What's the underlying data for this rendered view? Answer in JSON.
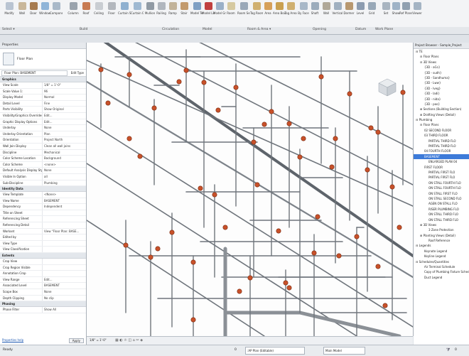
{
  "ribbon": {
    "buttons": [
      {
        "label": "Modify",
        "color": "#b9c4d2"
      },
      {
        "label": "Wall",
        "color": "#c9b79a"
      },
      {
        "label": "Door",
        "color": "#a77b4f"
      },
      {
        "label": "Window",
        "color": "#8fb4d8"
      },
      {
        "label": "Component",
        "color": "#a9b9c9"
      },
      {
        "label": "Column",
        "color": "#9aa3ad"
      },
      {
        "label": "Roof",
        "color": "#c77a52"
      },
      {
        "label": "Ceiling",
        "color": "#c9cdd2"
      },
      {
        "label": "Floor",
        "color": "#b3b7bd"
      },
      {
        "label": "Curtain System",
        "color": "#8fb0d0"
      },
      {
        "label": "Curtain Grid",
        "color": "#9fb9d2"
      },
      {
        "label": "Mullion",
        "color": "#909aa4"
      },
      {
        "label": "Railing",
        "color": "#b0b6be"
      },
      {
        "label": "Ramp",
        "color": "#c2b39a"
      },
      {
        "label": "Stair",
        "color": "#c29a6d"
      },
      {
        "label": "Model Text",
        "color": "#7fa0c4"
      },
      {
        "label": "Model Line",
        "color": "#c04040"
      },
      {
        "label": "Model Group",
        "color": "#9ab0c8"
      },
      {
        "label": "Room",
        "color": "#d6c9a0"
      },
      {
        "label": "Room Separator",
        "color": "#9aa8b8"
      },
      {
        "label": "Tag Room",
        "color": "#d0b070"
      },
      {
        "label": "Area",
        "color": "#d6a05a"
      },
      {
        "label": "Area Boundary",
        "color": "#c9a050"
      },
      {
        "label": "Tag Area",
        "color": "#d0b070"
      },
      {
        "label": "By Face",
        "color": "#a8b8c8"
      },
      {
        "label": "Shaft",
        "color": "#9cacbc"
      },
      {
        "label": "Wall",
        "color": "#b0a898"
      },
      {
        "label": "Vertical",
        "color": "#a0b0c0"
      },
      {
        "label": "Dormer",
        "color": "#b89870"
      },
      {
        "label": "Level",
        "color": "#8c9cb0"
      },
      {
        "label": "Grid",
        "color": "#98a8b8"
      },
      {
        "label": "Set",
        "color": "#a8b4c0"
      },
      {
        "label": "Show",
        "color": "#9fb3c7"
      },
      {
        "label": "Ref Plane",
        "color": "#90a0b0"
      },
      {
        "label": "Viewer",
        "color": "#a4b4c4"
      }
    ],
    "panels": [
      {
        "label": "Select ▾"
      },
      {
        "label": "Build"
      },
      {
        "label": "Circulation"
      },
      {
        "label": "Model"
      },
      {
        "label": "Room & Area ▾"
      },
      {
        "label": "Opening"
      },
      {
        "label": "Datum"
      },
      {
        "label": "Work Plane"
      }
    ]
  },
  "properties": {
    "title": "Properties",
    "type_name": "Floor Plan",
    "selector": "Floor Plan: BASEMENT",
    "edit_type": "Edit Type",
    "groups": [
      {
        "name": "Graphics",
        "rows": [
          [
            "View Scale",
            "1/8\" = 1'-0\""
          ],
          [
            "Scale Value 1:",
            "96"
          ],
          [
            "Display Model",
            "Normal"
          ],
          [
            "Detail Level",
            "Fine"
          ],
          [
            "Parts Visibility",
            "Show Original"
          ],
          [
            "Visibility/Graphics Overrides",
            "Edit..."
          ],
          [
            "Graphic Display Options",
            "Edit..."
          ],
          [
            "Underlay",
            "None"
          ],
          [
            "Underlay Orientation",
            "Plan"
          ],
          [
            "Orientation",
            "Project North"
          ],
          [
            "Wall Join Display",
            "Clean all wall joins"
          ],
          [
            "Discipline",
            "Mechanical"
          ],
          [
            "Color Scheme Location",
            "Background"
          ],
          [
            "Color Scheme",
            "<none>"
          ],
          [
            "Default Analysis Display Style",
            "None"
          ],
          [
            "Visible In Option",
            "all"
          ],
          [
            "Sub-Discipline",
            "Plumbing"
          ]
        ]
      },
      {
        "name": "Identity Data",
        "rows": [
          [
            "View Template",
            "<None>"
          ],
          [
            "View Name",
            "BASEMENT"
          ],
          [
            "Dependency",
            "Independent"
          ],
          [
            "Title on Sheet",
            ""
          ],
          [
            "Referencing Sheet",
            ""
          ],
          [
            "Referencing Detail",
            ""
          ],
          [
            "Workset",
            "View \"Floor Plan: BASE..."
          ],
          [
            "Edited by",
            ""
          ],
          [
            "View Type",
            ""
          ],
          [
            "View Classification",
            ""
          ]
        ]
      },
      {
        "name": "Extents",
        "rows": [
          [
            "Crop View",
            ""
          ],
          [
            "Crop Region Visible",
            ""
          ],
          [
            "Annotation Crop",
            ""
          ],
          [
            "View Range",
            "Edit..."
          ],
          [
            "Associated Level",
            "BASEMENT"
          ],
          [
            "Scope Box",
            "None"
          ],
          [
            "Depth Clipping",
            "No clip"
          ]
        ]
      },
      {
        "name": "Phasing",
        "rows": [
          [
            "Phase Filter",
            "Show All"
          ]
        ]
      }
    ],
    "help_link": "Properties help",
    "apply": "Apply"
  },
  "browser": {
    "title": "Project Browser - Sample_Project",
    "items": [
      {
        "t": "⊟ TE",
        "d": 0
      },
      {
        "t": "⊟ Floor Plans",
        "d": 1
      },
      {
        "t": "⊟ 3D Views",
        "d": 1
      },
      {
        "t": "{3D - aCo}",
        "d": 2
      },
      {
        "t": "{3D - sudh}",
        "d": 2
      },
      {
        "t": "{3D - Sandhuma}",
        "d": 2
      },
      {
        "t": "{3D - Lww}",
        "d": 2
      },
      {
        "t": "{3D - lveg}",
        "d": 2
      },
      {
        "t": "{3D - ladi}",
        "d": 2
      },
      {
        "t": "{3D - nida}",
        "d": 2
      },
      {
        "t": "{3D - poo}",
        "d": 2
      },
      {
        "t": "⊞ Sections (Building Section)",
        "d": 1
      },
      {
        "t": "⊞ Drafting Views (Detail)",
        "d": 1
      },
      {
        "t": "⊟ Plumbing",
        "d": 0
      },
      {
        "t": "⊟ Floor Plans",
        "d": 1
      },
      {
        "t": "02 SECOND FLOOR",
        "d": 2
      },
      {
        "t": "03 THIRD FLOOR",
        "d": 2
      },
      {
        "t": "PARTIAL THIRD FLO",
        "d": 3
      },
      {
        "t": "PARTIAL THIRD FLO",
        "d": 3
      },
      {
        "t": "04 FOURTH FLOOR",
        "d": 2
      },
      {
        "t": "BASEMENT",
        "d": 2,
        "sel": true
      },
      {
        "t": "ENLARGED PLAN 04",
        "d": 3
      },
      {
        "t": "FIRST FLOOR",
        "d": 2
      },
      {
        "t": "PARTIAL FIRST FLO",
        "d": 3
      },
      {
        "t": "PARTIAL FIRST FLO",
        "d": 3
      },
      {
        "t": "ON STALL FOURTH FLO",
        "d": 3
      },
      {
        "t": "ON STALL FOURTH FLO",
        "d": 3
      },
      {
        "t": "ON STALL FIRST FLO",
        "d": 3
      },
      {
        "t": "ON STALL SECOND FLO",
        "d": 3
      },
      {
        "t": "AGEN ON STALL FLO",
        "d": 3
      },
      {
        "t": "RISER PLUMBING FLO",
        "d": 3
      },
      {
        "t": "ON STALL THIRD FLO",
        "d": 3
      },
      {
        "t": "ON STALL THIRD FLO",
        "d": 3
      },
      {
        "t": "⊞ 3D Views",
        "d": 1
      },
      {
        "t": "3 Zone Protection",
        "d": 3
      },
      {
        "t": "⊞ Planting Views (Detail)",
        "d": 1
      },
      {
        "t": "Roof Reference",
        "d": 3
      },
      {
        "t": "⊟ Legends",
        "d": 0
      },
      {
        "t": "Keynote Legend",
        "d": 2
      },
      {
        "t": "Keyline Legend",
        "d": 2
      },
      {
        "t": "⊟ Schedules/Quantities",
        "d": 0
      },
      {
        "t": "Air Terminal Schedule",
        "d": 2
      },
      {
        "t": "Copy of Plumbing Fixture Sched",
        "d": 2
      },
      {
        "t": "Duct Legend",
        "d": 2
      }
    ]
  },
  "viewbar": {
    "scale": "1/8\" = 1'-0\""
  },
  "status": {
    "ready": "Ready",
    "workset": "0",
    "active_workset": ":AP Plan (Editable)",
    "main_model": "Main Model",
    "filter": "0"
  }
}
